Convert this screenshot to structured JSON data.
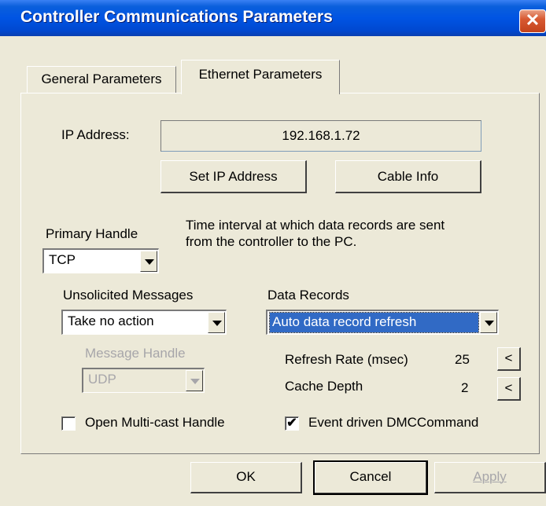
{
  "window": {
    "title": "Controller Communications Parameters",
    "close_glyph": "✕"
  },
  "tabs": [
    {
      "label": "General Parameters",
      "active": false
    },
    {
      "label": "Ethernet Parameters",
      "active": true
    }
  ],
  "ip": {
    "label": "IP Address:",
    "value": "192.168.1.72",
    "set_button": "Set IP Address",
    "cable_button": "Cable Info"
  },
  "primary_handle": {
    "label": "Primary Handle",
    "value": "TCP"
  },
  "description": {
    "line1": "Time interval at which data records are sent",
    "line2": "from the controller to the PC."
  },
  "unsolicited": {
    "label": "Unsolicited Messages",
    "value": "Take no action",
    "message_handle_label": "Message Handle",
    "message_handle_value": "UDP"
  },
  "data_records": {
    "label": "Data Records",
    "value": "Auto data record refresh",
    "refresh_rate_label": "Refresh Rate (msec)",
    "refresh_rate_value": "25",
    "cache_depth_label": "Cache Depth",
    "cache_depth_value": "2",
    "adjust_glyph": "<"
  },
  "options": {
    "multicast_label": "Open Multi-cast Handle",
    "multicast_checked": false,
    "event_driven_label": "Event driven DMCCommand",
    "event_driven_checked": true,
    "check_glyph": "✔"
  },
  "footer": {
    "ok": "OK",
    "cancel": "Cancel",
    "apply": "Apply"
  },
  "colors": {
    "dialog_bg": "#ECE9D8",
    "title_blue": "#0054E3",
    "selection_blue": "#316AC5",
    "disabled_text": "#A7A6AA"
  }
}
